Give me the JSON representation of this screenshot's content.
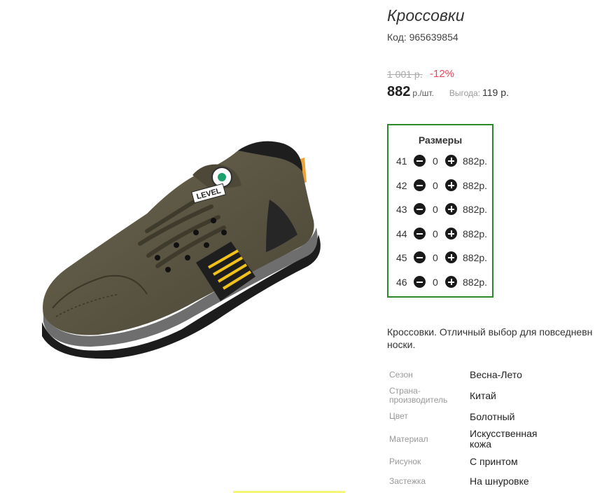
{
  "product": {
    "title": "Кроссовки",
    "code": "Код: 965639854"
  },
  "pricing": {
    "old_price": "1 001 р.",
    "discount": "-12%",
    "price": "882",
    "unit": "р./шт.",
    "benefit_label": "Выгода:",
    "benefit_value": "119 р."
  },
  "sizes": {
    "title": "Размеры",
    "rows": [
      {
        "size": "41",
        "qty": "0",
        "price": "882р."
      },
      {
        "size": "42",
        "qty": "0",
        "price": "882р."
      },
      {
        "size": "43",
        "qty": "0",
        "price": "882р."
      },
      {
        "size": "44",
        "qty": "0",
        "price": "882р."
      },
      {
        "size": "45",
        "qty": "0",
        "price": "882р."
      },
      {
        "size": "46",
        "qty": "0",
        "price": "882р."
      }
    ]
  },
  "description": {
    "line1": "Кроссовки. Отличный выбор для повседневн",
    "line2": "носки."
  },
  "attributes": [
    {
      "label": "Сезон",
      "value": "Весна-Лето"
    },
    {
      "label": "Страна-\nпроизводитель",
      "value": "Китай"
    },
    {
      "label": "Цвет",
      "value": "Болотный"
    },
    {
      "label": "Материал",
      "value": "Искусственная\nкожа"
    },
    {
      "label": "Рисунок",
      "value": "С принтом"
    },
    {
      "label": "Застежка",
      "value": "На шнуровке"
    }
  ],
  "image": {
    "brand_text": "LEVEL"
  },
  "colors": {
    "discount": "#e8455a",
    "sizes_border": "#2b8a2b",
    "shoe_body": "#5a5440",
    "shoe_accent": "#f2c21a"
  }
}
